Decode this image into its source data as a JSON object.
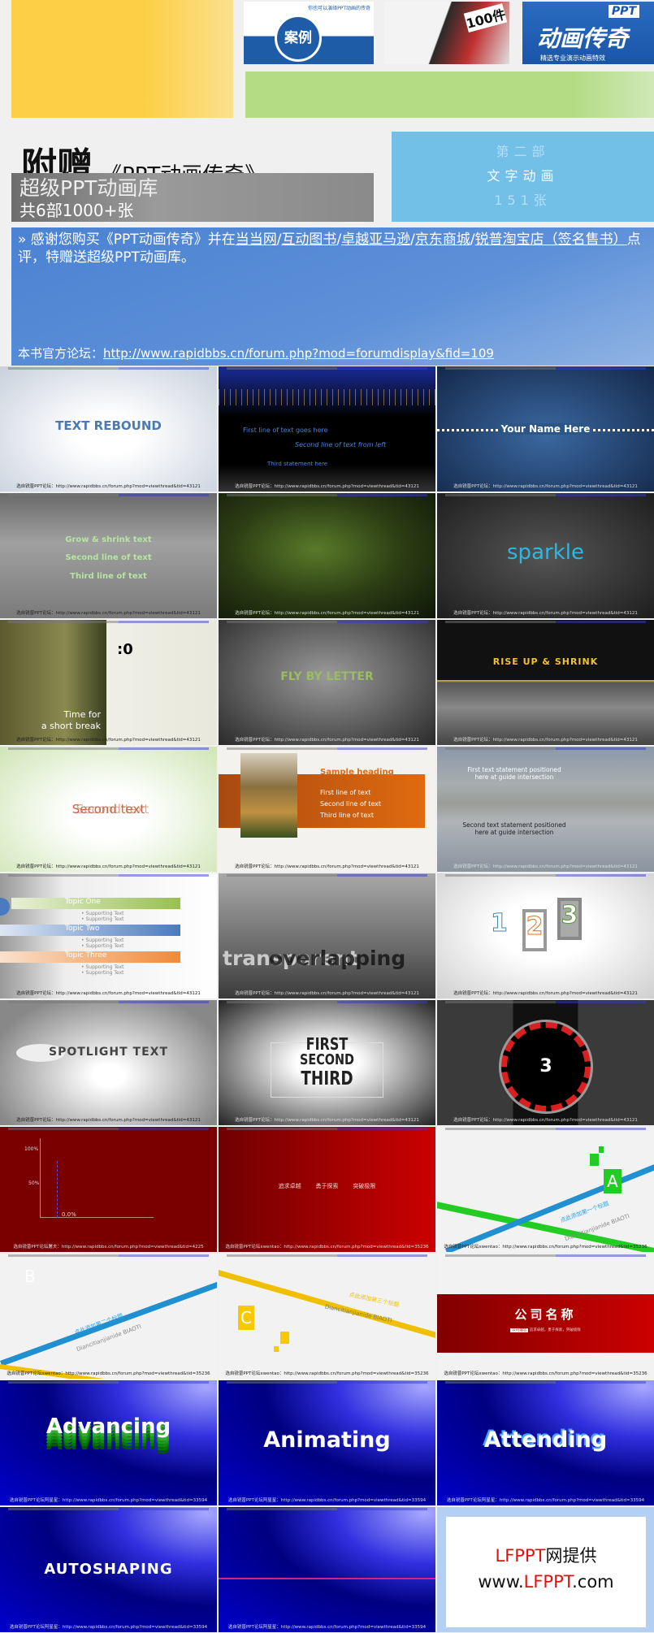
{
  "header": {
    "thumbs": [
      {
        "caption": "你也可以演绎PPT动画的传奇",
        "badge": "案例"
      },
      {
        "caption": "100件"
      },
      {
        "tag": "PPT",
        "title": "动画传奇",
        "sub": "精选专业演示动画特效"
      }
    ],
    "title_big": "附赠",
    "title_book": "《PPT动画传奇》",
    "lib_title": "超级PPT动画库",
    "lib_count": "共6部1000+张",
    "part": "第二部",
    "part_name": "文字动画",
    "part_count": "151张",
    "thanks_pre": "» 感谢您购买《PPT动画传奇》并在",
    "stores": [
      "当当网",
      "互动图书",
      "卓越亚马逊",
      "京东商城",
      "锐普淘宝店（签名售书）"
    ],
    "thanks_post": "点评，特赠送超级PPT动画库。",
    "forum_label": "本书官方论坛：",
    "forum_url": "http://www.rapidbbs.cn/forum.php?mod=forumdisplay&fid=109"
  },
  "footers": {
    "a": "选自锐普PPT论坛：http://www.rapidbbs.cn/forum.php?mod=viewthread&tid=43121",
    "b": "选自锐普PPT论坛屠夫：http://www.rapidbbs.cn/forum.php?mod=viewthread&tid=4225",
    "c": "选自锐普PPT论坛xwentao：http://www.rapidbbs.cn/forum.php?mod=viewthread&tid=35236",
    "d": "选自锐普PPT论坛阿星星：http://www.rapidbbs.cn/forum.php?mod=viewthread&tid=33594"
  },
  "tiles": {
    "t1": "TEXT REBOUND",
    "t2": [
      "First line of text goes here",
      "Second line of text from left",
      "Third statement here"
    ],
    "t3": "Your Name Here",
    "t4": [
      "Grow & shrink text",
      "Second line of text",
      "Third line of text"
    ],
    "t6": "sparkle",
    "t7": {
      "timer": ":0",
      "msg1": "Time for",
      "msg2": "a short break"
    },
    "t8": "FLY BY LETTER",
    "t9": "RISE UP & SHRINK",
    "t10": "Second text",
    "t11": {
      "heading": "Sample heading",
      "lines": [
        "First line of text",
        "Second line of text",
        "Third line of text"
      ]
    },
    "t12": {
      "first": "First text statement positioned here at guide intersection",
      "second": "Second text statement positioned here at guide intersection"
    },
    "t13": {
      "topics": [
        "Topic One",
        "Topic Two",
        "Topic Three"
      ],
      "support": "Supporting Text"
    },
    "t14": {
      "a": "transparent",
      "b": "overlapping"
    },
    "t15": [
      "1",
      "2",
      "3"
    ],
    "t16": "SPOTLIGHT TEXT",
    "t17": [
      "FIRST",
      "SECOND",
      "THIRD"
    ],
    "t18": "3",
    "t19": [
      "100%",
      "50%",
      "0.0%"
    ],
    "t20": [
      "追求卓越",
      "勇于探索",
      "突破极限"
    ],
    "t21": {
      "letter": "A",
      "cn": "点此添加第一个标题",
      "en": "Diancitianjianide BIAOTI"
    },
    "t22": {
      "letter": "B",
      "cn": "点此添加第二个标题",
      "en": "Diancitianjianide BIAOTI"
    },
    "t23": {
      "letter": "C",
      "cn": "点此添加第三个标题",
      "en": "Diancitianjianide BIAOTI"
    },
    "t24": {
      "name": "公司名称",
      "tag": "公司理念",
      "slogan": "追求卓越，勇于探索，突破极限"
    },
    "t25": "Advancing",
    "t26": "Animating",
    "t27": "Attending",
    "t28": "AUTOSHAPING",
    "t30": {
      "l1a": "LFPPT",
      "l1b": "网提供",
      "l2a": "www.",
      "l2b": "LFPPT",
      ".com": ".com"
    }
  },
  "colors": {
    "yellow": "#fccf45",
    "green": "#b3dc84",
    "lightblue": "#72bfe8",
    "blue": "#4b82d2",
    "red": "#c00000"
  }
}
